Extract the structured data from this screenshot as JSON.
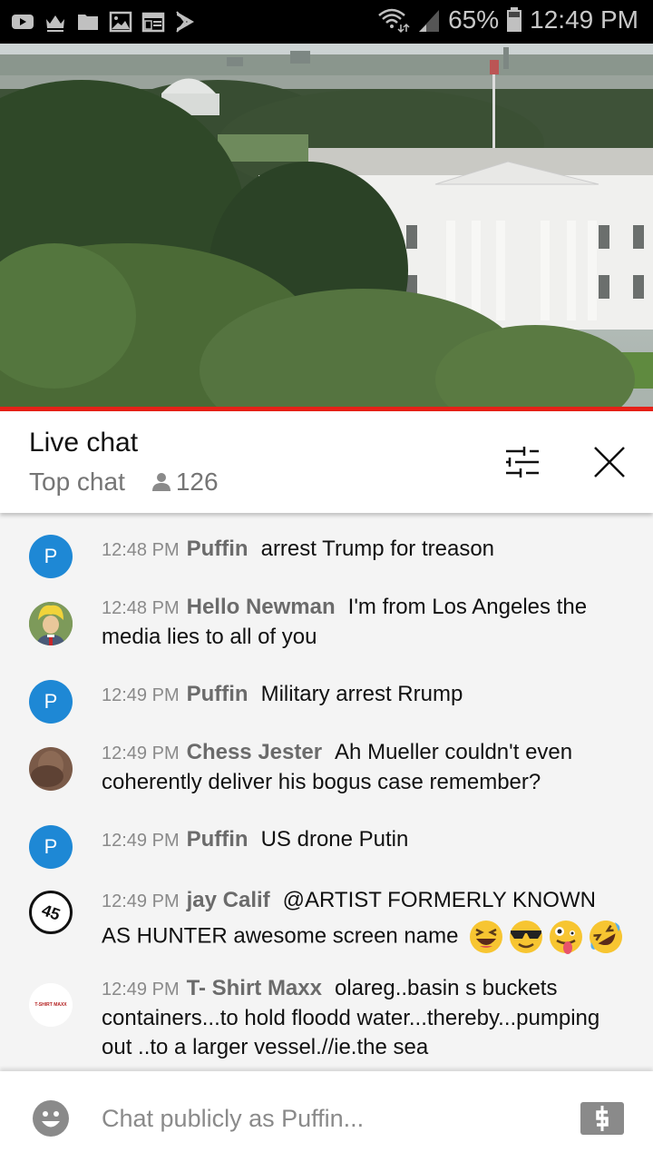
{
  "status_bar": {
    "notification_icons": [
      "youtube-icon",
      "crown-icon",
      "folder-icon",
      "gallery-icon",
      "calendar-news-icon",
      "play-store-icon"
    ],
    "wifi": "wifi-icon",
    "signal": "signal-icon",
    "battery_percent": "65%",
    "time": "12:49 PM"
  },
  "video": {
    "description": "Live stream view of the White House with trees in foreground",
    "progress_color": "#e62117"
  },
  "chat_header": {
    "title": "Live chat",
    "mode": "Top chat",
    "viewer_count": "126",
    "filter_icon": "sliders-icon",
    "close_icon": "close-icon"
  },
  "messages": [
    {
      "avatar_type": "letter",
      "avatar_letter": "P",
      "time": "12:48 PM",
      "author": "Puffin",
      "text": "arrest Trump for treason"
    },
    {
      "avatar_type": "image",
      "avatar_desc": "cartoon-portrait",
      "time": "12:48 PM",
      "author": "Hello Newman",
      "text": "I'm from Los Angeles the media lies to all of you"
    },
    {
      "avatar_type": "letter",
      "avatar_letter": "P",
      "time": "12:49 PM",
      "author": "Puffin",
      "text": "Military arrest Rrump"
    },
    {
      "avatar_type": "image",
      "avatar_desc": "photo-portrait",
      "time": "12:49 PM",
      "author": "Chess Jester",
      "text": "Ah Mueller couldn't even coherently deliver his bogus case remember?"
    },
    {
      "avatar_type": "letter",
      "avatar_letter": "P",
      "time": "12:49 PM",
      "author": "Puffin",
      "text": "US drone Putin"
    },
    {
      "avatar_type": "image",
      "avatar_desc": "45-ball",
      "avatar_text": "45",
      "time": "12:49 PM",
      "author": "jay Calif",
      "text": "@ARTIST FORMERLY KNOWN AS HUNTER awesome screen name",
      "emojis": [
        "grinning-squint-emoji",
        "sunglasses-emoji",
        "zany-face-emoji",
        "rofl-emoji"
      ]
    },
    {
      "avatar_type": "image",
      "avatar_desc": "tshirt-maxx-logo",
      "avatar_text": "T-SHIRT MAXX",
      "time": "12:49 PM",
      "author": "T- Shirt Maxx",
      "text": "olareg..basin s buckets containers...to hold floodd water...thereby...pumping out ..to a larger vessel.//ie.the sea"
    }
  ],
  "input_bar": {
    "placeholder": "Chat publicly as Puffin...",
    "value": "",
    "emoji_icon": "smiley-icon",
    "superchat_icon": "dollar-icon"
  },
  "colors": {
    "accent_red": "#e62117",
    "avatar_blue": "#1e88d5",
    "timestamp_gray": "#8a8a8a",
    "author_gray": "#6b6b6b"
  }
}
